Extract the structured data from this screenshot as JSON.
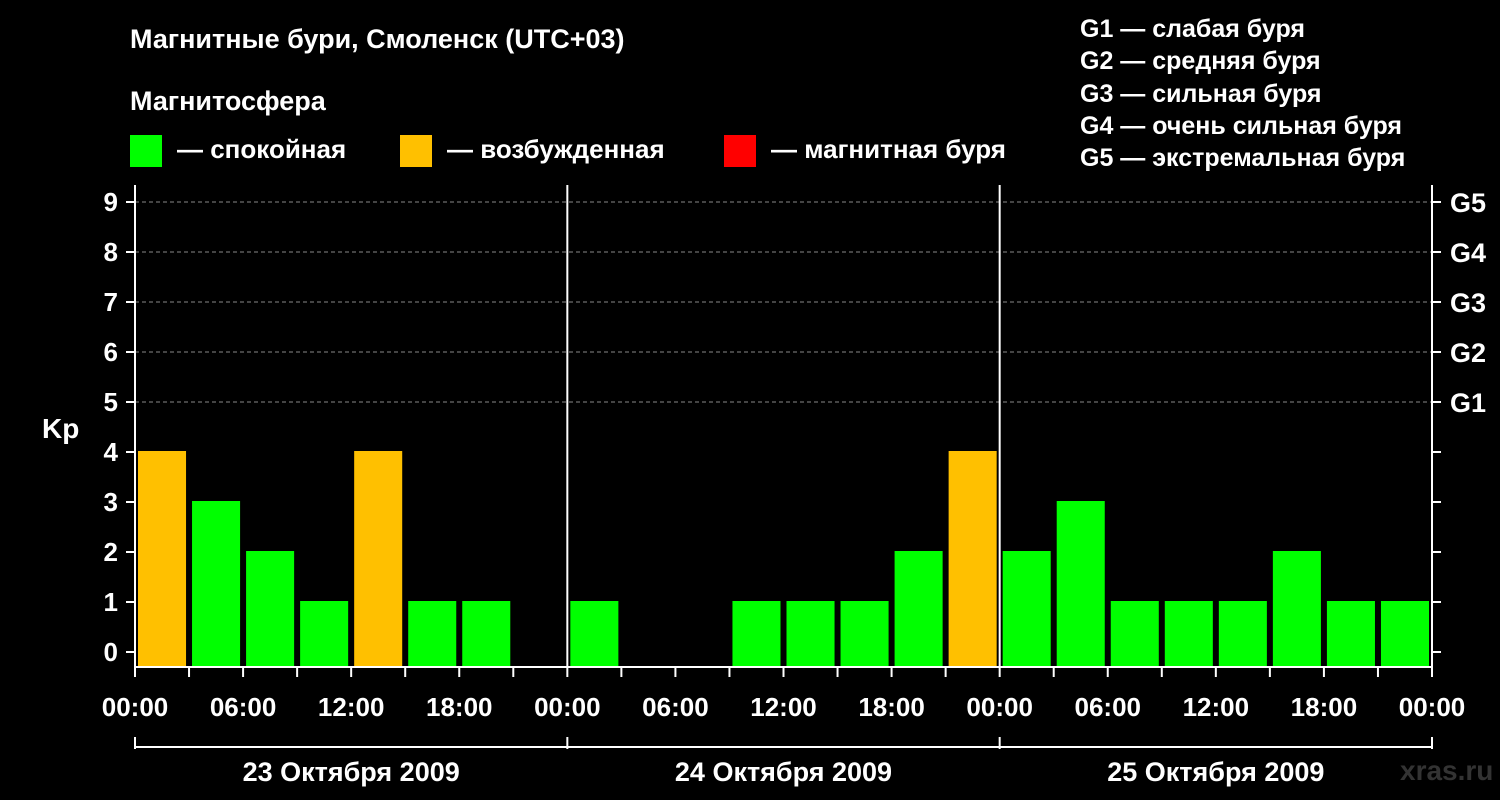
{
  "header": {
    "title": "Магнитные бури, Смоленск (UTC+03)",
    "subtitle": "Магнитосфера"
  },
  "legend": [
    {
      "label": "— спокойная",
      "color": "#00ff00"
    },
    {
      "label": "— возбужденная",
      "color": "#ffc000"
    },
    {
      "label": "— магнитная буря",
      "color": "#ff0000"
    }
  ],
  "g_scale": [
    "G1 — слабая буря",
    "G2 — средняя буря",
    "G3 — сильная буря",
    "G4 — очень сильная буря",
    "G5 — экстремальная буря"
  ],
  "watermark": "xras.ru",
  "chart_data": {
    "type": "bar",
    "ylabel": "Kp",
    "ylim": [
      0,
      9
    ],
    "y_ticks": [
      0,
      1,
      2,
      3,
      4,
      5,
      6,
      7,
      8,
      9
    ],
    "right_ticks": [
      {
        "value": 5,
        "label": "G1"
      },
      {
        "value": 6,
        "label": "G2"
      },
      {
        "value": 7,
        "label": "G3"
      },
      {
        "value": 8,
        "label": "G4"
      },
      {
        "value": 9,
        "label": "G5"
      }
    ],
    "x_ticks": [
      "00:00",
      "06:00",
      "12:00",
      "18:00",
      "00:00",
      "06:00",
      "12:00",
      "18:00",
      "00:00",
      "06:00",
      "12:00",
      "18:00",
      "00:00"
    ],
    "days": [
      "23 Октября 2009",
      "24 Октября 2009",
      "25 Октября 2009"
    ],
    "interval_hours": 3,
    "grid": "dashed at 5-9",
    "colors": {
      "quiet": "#00ff00",
      "active": "#ffc000",
      "storm": "#ff0000"
    },
    "values": [
      4,
      3,
      2,
      1,
      4,
      1,
      1,
      null,
      1,
      null,
      null,
      1,
      1,
      1,
      2,
      4,
      2,
      3,
      1,
      1,
      1,
      2,
      1,
      1
    ]
  }
}
